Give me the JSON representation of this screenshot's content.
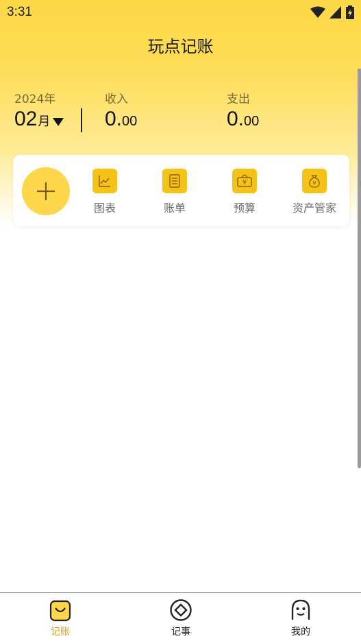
{
  "status_bar": {
    "time": "3:31"
  },
  "app": {
    "title": "玩点记账"
  },
  "summary": {
    "year": "2024年",
    "month": "02",
    "month_unit": "月",
    "income_label": "收入",
    "income_int": "0.",
    "income_dec": "00",
    "expense_label": "支出",
    "expense_int": "0.",
    "expense_dec": "00"
  },
  "shortcuts": [
    {
      "label": "图表",
      "icon": "chart-icon"
    },
    {
      "label": "账单",
      "icon": "bill-icon"
    },
    {
      "label": "预算",
      "icon": "budget-icon"
    },
    {
      "label": "资产管家",
      "icon": "money-bag-icon"
    }
  ],
  "tabs": [
    {
      "label": "记账",
      "icon": "bag-icon",
      "active": true
    },
    {
      "label": "记事",
      "icon": "diamond-circle-icon",
      "active": false
    },
    {
      "label": "我的",
      "icon": "face-icon",
      "active": false
    }
  ],
  "colors": {
    "accent": "#fdd64a",
    "icon_bg": "#f5c218",
    "active_tab": "#e8a000"
  }
}
